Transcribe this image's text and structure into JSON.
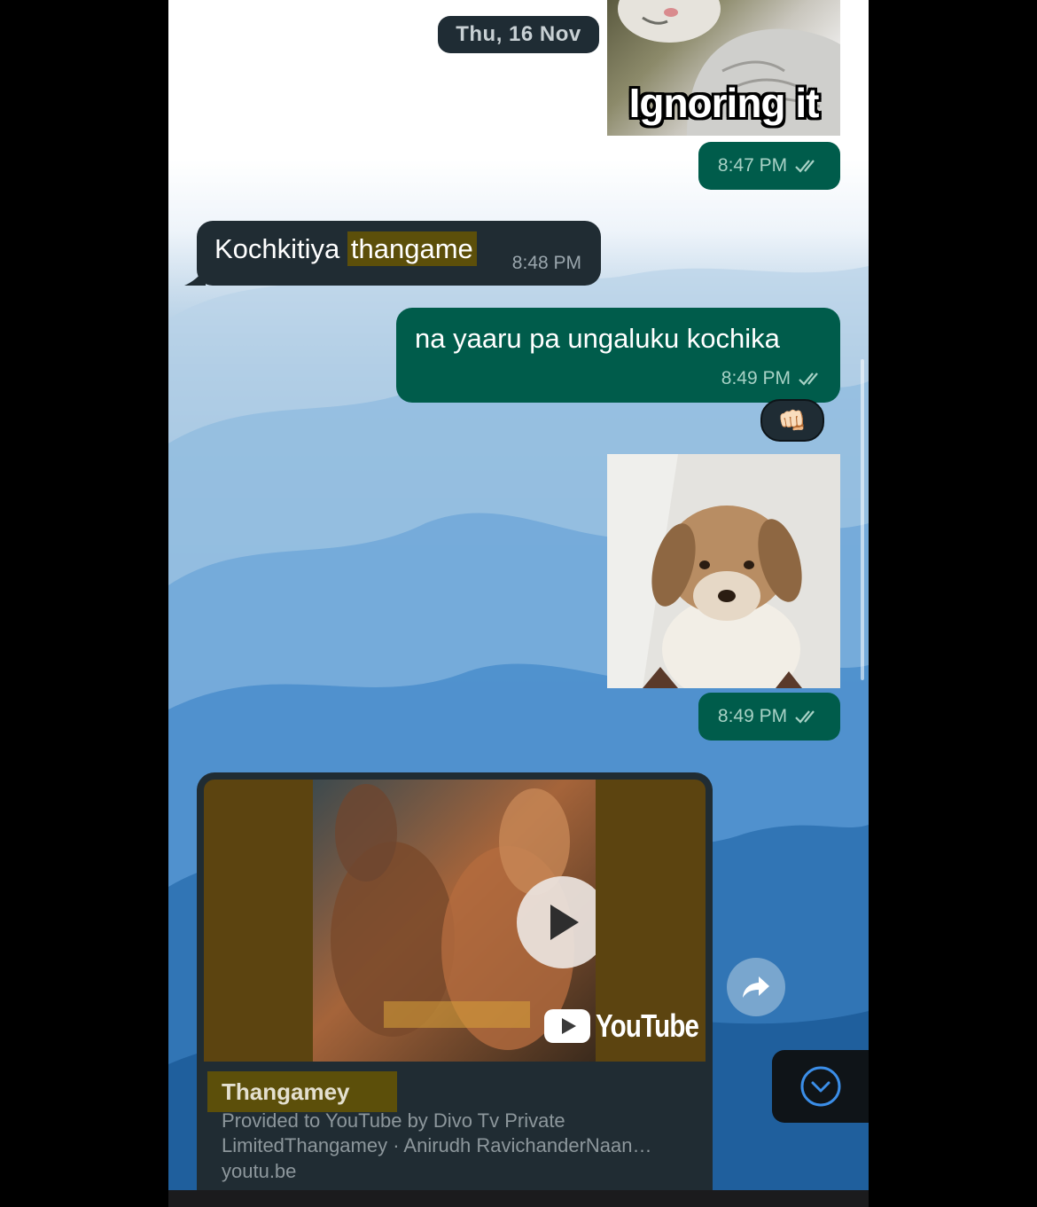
{
  "date_separator": "Thu, 16 Nov",
  "messages": [
    {
      "id": "m1",
      "direction": "outgoing",
      "type": "sticker",
      "sticker_caption": "Ignoring it",
      "time": "8:47 PM",
      "status": "read"
    },
    {
      "id": "m2",
      "direction": "incoming",
      "type": "text",
      "text_plain": "Kochkitiya",
      "text_highlight": "thangame",
      "time": "8:48 PM"
    },
    {
      "id": "m3",
      "direction": "outgoing",
      "type": "text",
      "text": "na yaaru pa ungaluku kochika",
      "time": "8:49 PM",
      "status": "read",
      "reaction": "👊🏻"
    },
    {
      "id": "m4",
      "direction": "outgoing",
      "type": "sticker",
      "time": "8:49 PM",
      "status": "read"
    },
    {
      "id": "m5",
      "direction": "incoming",
      "type": "link",
      "link": {
        "title": "Thangamey",
        "description": "Provided to YouTube by Divo Tv Private LimitedThangamey · Anirudh RavichanderNaan…",
        "domain": "youtu.be",
        "provider": "YouTube"
      }
    }
  ],
  "icons": {
    "read_receipt": "double-check-icon",
    "forward": "forward-icon",
    "scroll_down": "chevron-down-circle-icon",
    "play": "play-icon"
  },
  "colors": {
    "outgoing_bubble": "#005c4b",
    "incoming_bubble": "#202c33",
    "highlight": "#5c4f0a",
    "read_tick": "#a8d2c6"
  }
}
